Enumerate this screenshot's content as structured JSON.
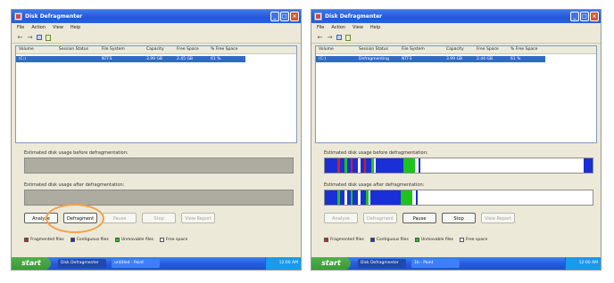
{
  "panels": [
    {
      "window": {
        "title": "Disk Defragmenter",
        "min": "_",
        "max": "□",
        "close": "×"
      },
      "menu": [
        "File",
        "Action",
        "View",
        "Help"
      ],
      "columns": [
        "Volume",
        "Session Status",
        "File System",
        "Capacity",
        "Free Space",
        "% Free Space"
      ],
      "row": [
        "(C:)",
        "",
        "NTFS",
        "3.99 GB",
        "2.45 GB",
        "61 %"
      ],
      "before_label": "Estimated disk usage before defragmentation:",
      "after_label": "Estimated disk usage after defragmentation:",
      "buttons": [
        {
          "label": "Analyze",
          "enabled": true
        },
        {
          "label": "Defragment",
          "enabled": true
        },
        {
          "label": "Pause",
          "enabled": false
        },
        {
          "label": "Stop",
          "enabled": false
        },
        {
          "label": "View Report",
          "enabled": false
        }
      ],
      "legend": [
        "Fragmented files",
        "Contiguous files",
        "Unmovable files",
        "Free space"
      ],
      "taskbar": {
        "start": "start",
        "tasks": [
          "Disk Defragmenter",
          "untitled - Paint"
        ],
        "clock": "12:00 AM"
      }
    },
    {
      "window": {
        "title": "Disk Defragmenter",
        "min": "_",
        "max": "□",
        "close": "×"
      },
      "menu": [
        "File",
        "Action",
        "View",
        "Help"
      ],
      "columns": [
        "Volume",
        "Session Status",
        "File System",
        "Capacity",
        "Free Space",
        "% Free Space"
      ],
      "row": [
        "(C:)",
        "Defragmenting",
        "NTFS",
        "3.99 GB",
        "2.44 GB",
        "61 %"
      ],
      "before_label": "Estimated disk usage before defragmentation:",
      "after_label": "Estimated disk usage after defragmentation:",
      "buttons": [
        {
          "label": "Analyze",
          "enabled": false
        },
        {
          "label": "Defragment",
          "enabled": false
        },
        {
          "label": "Pause",
          "enabled": true
        },
        {
          "label": "Stop",
          "enabled": true
        },
        {
          "label": "View Report",
          "enabled": false
        }
      ],
      "legend": [
        "Fragmented files",
        "Contiguous files",
        "Unmovable files",
        "Free space"
      ],
      "taskbar": {
        "start": "start",
        "tasks": [
          "Disk Defragmenter",
          "1b - Paint"
        ],
        "clock": "12:00 AM"
      }
    }
  ],
  "colors": {
    "fragmented": "#d42020",
    "contiguous": "#1a2fd6",
    "unmovable": "#1cc41c",
    "free": "#ffffff",
    "highlight_ring": "#f2a24a"
  }
}
